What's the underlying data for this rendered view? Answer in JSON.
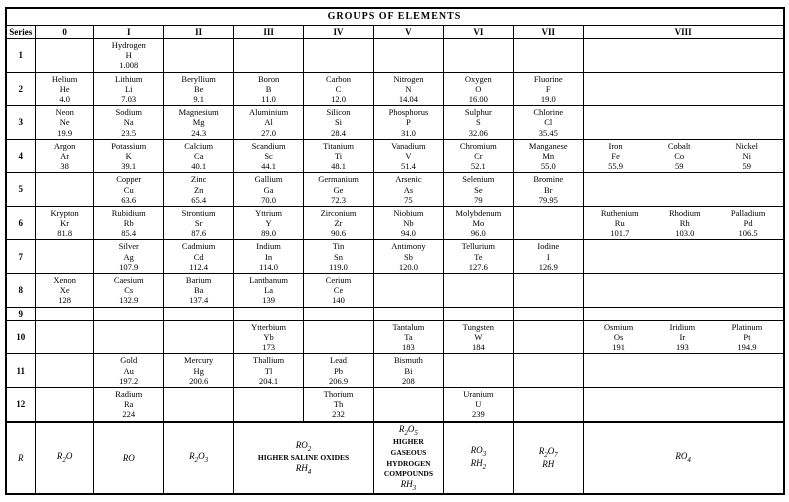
{
  "title": "GROUPS OF ELEMENTS",
  "columns": {
    "series": "Series",
    "groups": [
      "0",
      "I",
      "II",
      "III",
      "IV",
      "V",
      "VI",
      "VII",
      "VIII"
    ]
  },
  "rows": [
    {
      "series": "1",
      "cells": {
        "0": "",
        "I": {
          "name": "Hydrogen",
          "sym": "H",
          "num": "1.008"
        },
        "II": "",
        "III": "",
        "IV": "",
        "V": "",
        "VI": "",
        "VII": "",
        "VIII": ""
      }
    }
  ],
  "footer": {
    "higher_saline": "HIGHER SALINE OXIDES",
    "higher_gaseous": "HIGHER GASEOUS HYDROGEN COMPOUNDS",
    "R": "R",
    "R2O": "R₂O",
    "RO": "RO",
    "R2O3": "R₂O₃",
    "RO2": "RO₂",
    "R2O5": "R₂O₅",
    "RO3": "RO₃",
    "R2O7": "R₂O₇",
    "RO4": "RO₄",
    "RH4": "RH₄",
    "RH3": "RH₃",
    "RH2": "RH₂",
    "RH": "RH"
  }
}
